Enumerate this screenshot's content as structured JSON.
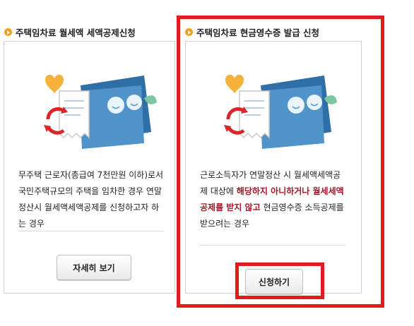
{
  "left_panel": {
    "title": "주택임차료 월세액 세액공제신청",
    "description": "무주택 근로자(총급여 7천만원 이하)로서 국민주택규모의 주택을 임차한 경우 연말정산시 월세액세액공제를 신청하고자 하는 경우",
    "button_label": "자세히 보기"
  },
  "right_panel": {
    "title": "주택임차료 현금영수증 발급 신청",
    "description_before": "근로소득자가 연말정산 시 월세액세액공제 대상에 ",
    "description_highlight": "해당하지 아니하거나 월세세액공제를 받지 않고",
    "description_after": " 현금영수증 소득공제를 받으려는 경우",
    "button_label": "신청하기"
  },
  "colors": {
    "highlight": "#a3172b",
    "annotation_box": "#e41b1b",
    "bullet": "#f0a020"
  },
  "icons": [
    "heart-icon",
    "receipt-icon",
    "refresh-arrows-icon",
    "card-folder-icon",
    "leaf-icon"
  ]
}
